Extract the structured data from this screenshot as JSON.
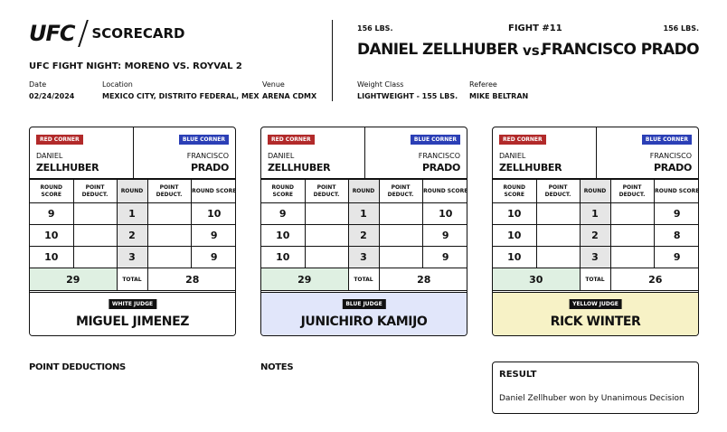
{
  "header": {
    "brand": "UFC",
    "subtitle": "SCORECARD",
    "event": "UFC FIGHT NIGHT: MORENO VS. ROYVAL 2",
    "date_label": "Date",
    "date": "02/24/2024",
    "location_label": "Location",
    "location": "MEXICO CITY, DISTRITO FEDERAL, MEX",
    "venue_label": "Venue",
    "venue": "ARENA CDMX",
    "weight_class_label": "Weight Class",
    "weight_class": "LIGHTWEIGHT - 155 LBS.",
    "referee_label": "Referee",
    "referee": "MIKE BELTRAN",
    "fight_number": "FIGHT #11",
    "red_weight": "156 LBS.",
    "blue_weight": "156 LBS.",
    "red_fighter": "DANIEL ZELLHUBER",
    "blue_fighter": "FRANCISCO PRADO",
    "vs": "vs."
  },
  "labels": {
    "red_corner": "RED CORNER",
    "blue_corner": "BLUE CORNER",
    "red_first": "DANIEL",
    "red_last": "ZELLHUBER",
    "blue_first": "FRANCISCO",
    "blue_last": "PRADO",
    "round_score": "ROUND SCORE",
    "point_deduct": "POINT DEDUCT.",
    "round": "ROUND",
    "total": "TOTAL"
  },
  "colors": {
    "red_corner": "#b22a2a",
    "blue_corner": "#2b3fb6",
    "white_judge_bg": "#ffffff",
    "blue_judge_bg": "#e1e6fa",
    "yellow_judge_bg": "#f7f2c6",
    "red_total_bg": "#dff0e2"
  },
  "judges": [
    {
      "tag": "WHITE JUDGE",
      "name": "MIGUEL JIMENEZ",
      "rounds": [
        {
          "round": "1",
          "red_score": "9",
          "red_deduct": "",
          "blue_deduct": "",
          "blue_score": "10"
        },
        {
          "round": "2",
          "red_score": "10",
          "red_deduct": "",
          "blue_deduct": "",
          "blue_score": "9"
        },
        {
          "round": "3",
          "red_score": "10",
          "red_deduct": "",
          "blue_deduct": "",
          "blue_score": "9"
        }
      ],
      "red_total": "29",
      "blue_total": "28"
    },
    {
      "tag": "BLUE JUDGE",
      "name": "JUNICHIRO KAMIJO",
      "rounds": [
        {
          "round": "1",
          "red_score": "9",
          "red_deduct": "",
          "blue_deduct": "",
          "blue_score": "10"
        },
        {
          "round": "2",
          "red_score": "10",
          "red_deduct": "",
          "blue_deduct": "",
          "blue_score": "9"
        },
        {
          "round": "3",
          "red_score": "10",
          "red_deduct": "",
          "blue_deduct": "",
          "blue_score": "9"
        }
      ],
      "red_total": "29",
      "blue_total": "28"
    },
    {
      "tag": "YELLOW JUDGE",
      "name": "RICK WINTER",
      "rounds": [
        {
          "round": "1",
          "red_score": "10",
          "red_deduct": "",
          "blue_deduct": "",
          "blue_score": "9"
        },
        {
          "round": "2",
          "red_score": "10",
          "red_deduct": "",
          "blue_deduct": "",
          "blue_score": "8"
        },
        {
          "round": "3",
          "red_score": "10",
          "red_deduct": "",
          "blue_deduct": "",
          "blue_score": "9"
        }
      ],
      "red_total": "30",
      "blue_total": "26"
    }
  ],
  "footer": {
    "point_deductions_title": "POINT DEDUCTIONS",
    "notes_title": "NOTES",
    "result_title": "RESULT",
    "result_text": "Daniel Zellhuber won by Unanimous Decision"
  }
}
